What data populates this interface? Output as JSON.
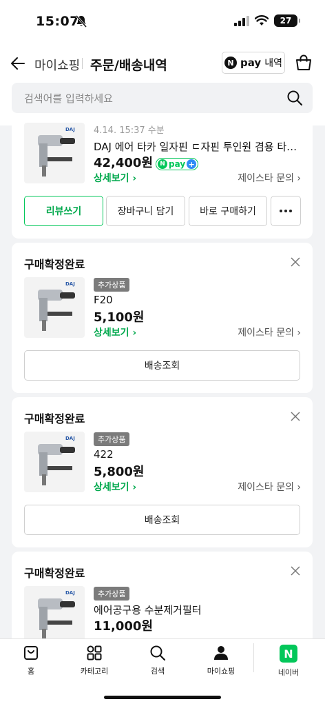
{
  "status_bar": {
    "time": "15:07",
    "battery": "27"
  },
  "header": {
    "my_shopping": "마이쇼핑",
    "title": "주문/배송내역",
    "npay_n": "N",
    "npay_pay": "pay",
    "npay_label": "내역"
  },
  "search": {
    "placeholder": "검색어를 입력하세요"
  },
  "orders": [
    {
      "date": "4.14. 15:37 수분",
      "name": "DAJ 에어 타카 일자핀 ㄷ자핀 투인원 겸용 타카총 ...",
      "price": "42,400원",
      "npay_badge": "pay",
      "detail": "상세보기 ›",
      "inquiry": "제이스타 문의 ›",
      "buttons": {
        "review": "리뷰쓰기",
        "cart": "장바구니 담기",
        "buy_now": "바로 구매하기"
      }
    },
    {
      "status": "구매확정완료",
      "badge": "추가상품",
      "name": "F20",
      "price": "5,100원",
      "detail": "상세보기 ›",
      "inquiry": "제이스타 문의 ›",
      "track": "배송조회"
    },
    {
      "status": "구매확정완료",
      "badge": "추가상품",
      "name": "422",
      "price": "5,800원",
      "detail": "상세보기 ›",
      "inquiry": "제이스타 문의 ›",
      "track": "배송조회"
    },
    {
      "status": "구매확정완료",
      "badge": "추가상품",
      "name": "에어공구용 수분제거필터",
      "price": "11,000원"
    }
  ],
  "bottom_nav": [
    {
      "label": "홈",
      "icon": "home-bag-icon"
    },
    {
      "label": "카테고리",
      "icon": "category-grid-icon"
    },
    {
      "label": "검색",
      "icon": "search-icon"
    },
    {
      "label": "마이쇼핑",
      "icon": "person-icon"
    },
    {
      "label": "네이버",
      "icon": "naver-n-icon"
    }
  ],
  "brand_logo": "DAJ",
  "colors": {
    "accent_green": "#03c75a",
    "npay_plus_blue": "#2f8cf6"
  }
}
